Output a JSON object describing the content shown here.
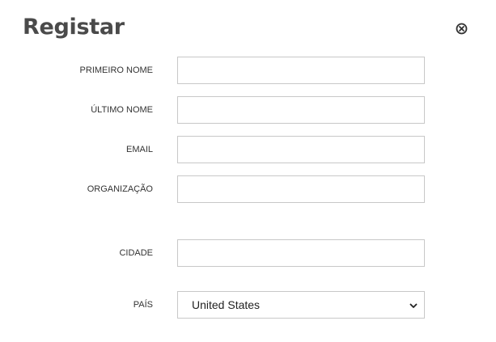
{
  "dialog": {
    "title": "Registar",
    "close_icon": "close-circle-icon"
  },
  "form": {
    "first_name": {
      "label": "PRIMEIRO NOME",
      "value": ""
    },
    "last_name": {
      "label": "ÚLTIMO NOME",
      "value": ""
    },
    "email": {
      "label": "EMAIL",
      "value": ""
    },
    "organization": {
      "label": "ORGANIZAÇÃO",
      "value": ""
    },
    "city": {
      "label": "CIDADE",
      "value": ""
    },
    "country": {
      "label": "PAÍS",
      "selected": "United States",
      "chevron_icon": "chevron-down-icon"
    }
  },
  "colors": {
    "title": "#4a4a4a",
    "label": "#333333",
    "input_border": "#c8c8c8"
  }
}
